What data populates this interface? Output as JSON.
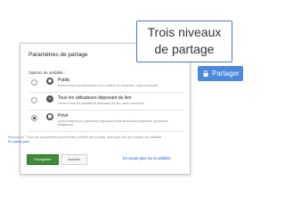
{
  "callout": {
    "line1": "Trois niveaux",
    "line2": "de partage"
  },
  "share_button": {
    "label": "Partager",
    "icon": "lock-icon"
  },
  "dialog": {
    "title": "Paramètres de partage",
    "section_label": "Options de visibilité :",
    "options": [
      {
        "title": "Public",
        "description": "Accès à tous les internautes via le moteur de recherche, sans connexion",
        "icon": "globe-icon",
        "selected": false
      },
      {
        "title": "Tous les utilisateurs disposant du lien",
        "description": "Accès à tous les utilisateurs disposant du lien, sans connexion",
        "icon": "link-icon",
        "selected": false
      },
      {
        "title": "Privé",
        "description": "Accès réservé aux personnes disposant d'une autorisation expresse (connexion obligatoire)",
        "icon": "lock-icon",
        "selected": true
      }
    ],
    "remark": "Remarque : Tous les documents peuvent être publiés par la suite, quel que soit leur niveau de visibilité.",
    "remark_link": "En savoir plus",
    "save_label": "Enregistrer",
    "cancel_label": "Annuler",
    "more_link": "En savoir plus sur la visibilité"
  },
  "colors": {
    "accent_blue": "#4a89dc",
    "save_green": "#3d8b37",
    "link": "#1a56c4"
  }
}
